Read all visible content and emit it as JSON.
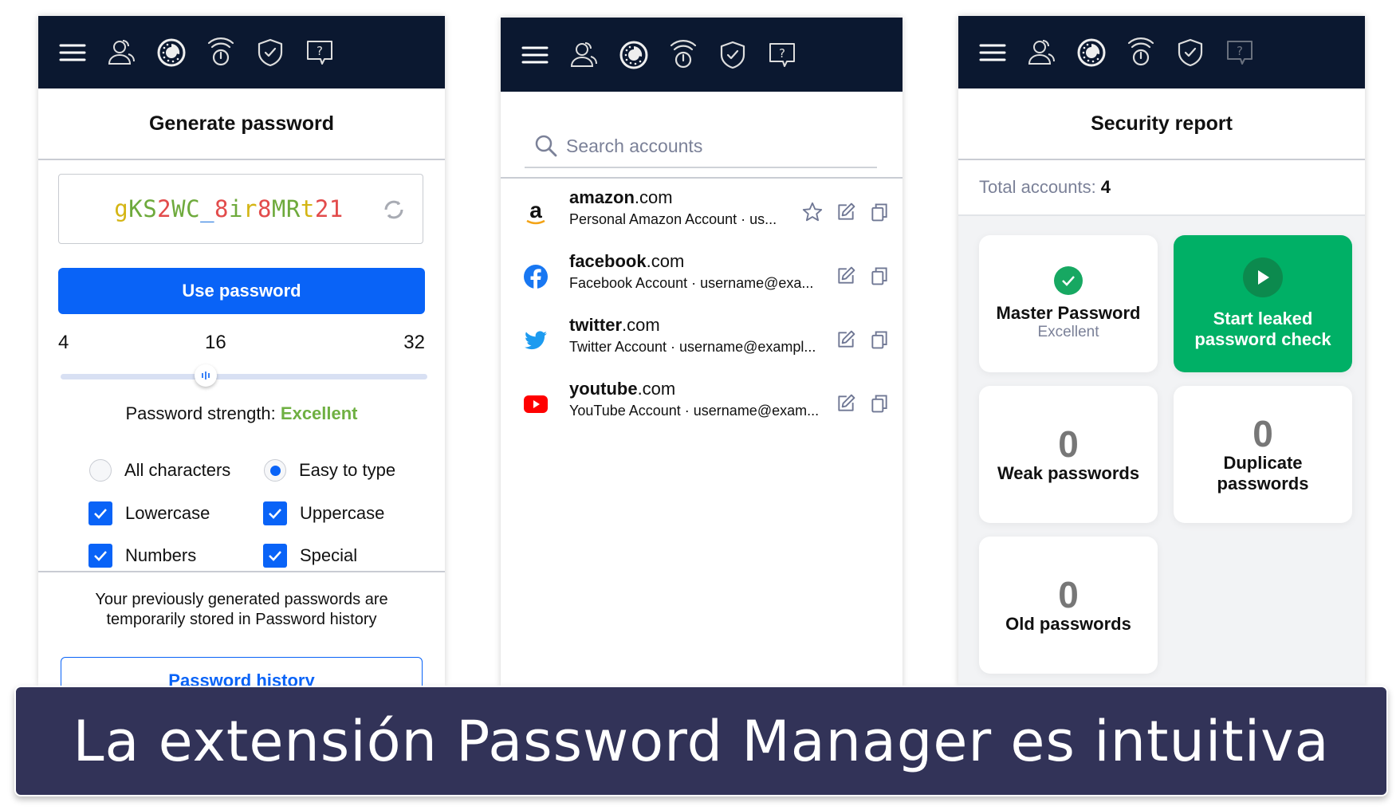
{
  "toolbar": {
    "icons": [
      "menu-icon",
      "accounts-icon",
      "identity-dial-icon",
      "authenticator-icon",
      "security-shield-icon",
      "help-chat-icon"
    ]
  },
  "generator": {
    "title": "Generate password",
    "password": "gKS2WC_8ir8MRt21",
    "password_chars": [
      {
        "c": "g",
        "color": "#d4b514"
      },
      {
        "c": "K",
        "color": "#6eaa3c"
      },
      {
        "c": "S",
        "color": "#6eaa3c"
      },
      {
        "c": "2",
        "color": "#e24b4b"
      },
      {
        "c": "W",
        "color": "#6eaa3c"
      },
      {
        "c": "C",
        "color": "#6eaa3c"
      },
      {
        "c": "_",
        "color": "#2a7be0"
      },
      {
        "c": "8",
        "color": "#e24b4b"
      },
      {
        "c": "i",
        "color": "#6eaa3c"
      },
      {
        "c": "r",
        "color": "#d4b514"
      },
      {
        "c": "8",
        "color": "#e24b4b"
      },
      {
        "c": "M",
        "color": "#6eaa3c"
      },
      {
        "c": "R",
        "color": "#6eaa3c"
      },
      {
        "c": "t",
        "color": "#d4b514"
      },
      {
        "c": "2",
        "color": "#e24b4b"
      },
      {
        "c": "1",
        "color": "#e24b4b"
      }
    ],
    "use_button": "Use password",
    "length_min": "4",
    "length_value": "16",
    "length_max": "32",
    "strength_label": "Password strength:",
    "strength_value": "Excellent",
    "options": {
      "all_characters": {
        "label": "All characters",
        "selected": false
      },
      "easy_to_type": {
        "label": "Easy to type",
        "selected": true
      },
      "lowercase": {
        "label": "Lowercase",
        "checked": true
      },
      "uppercase": {
        "label": "Uppercase",
        "checked": true
      },
      "numbers": {
        "label": "Numbers",
        "checked": true
      },
      "special": {
        "label": "Special",
        "checked": true
      }
    },
    "history_note_1": "Your previously generated passwords are",
    "history_note_2": "temporarily stored in Password history",
    "history_button": "Password history"
  },
  "accounts": {
    "search_placeholder": "Search accounts",
    "items": [
      {
        "name": "amazon",
        "tld": ".com",
        "sub": "Personal Amazon Account · us...",
        "starred_icon": true,
        "logo": "amazon-logo"
      },
      {
        "name": "facebook",
        "tld": ".com",
        "sub": "Facebook Account · username@exa...",
        "starred_icon": false,
        "logo": "facebook-logo"
      },
      {
        "name": "twitter",
        "tld": ".com",
        "sub": "Twitter Account · username@exampl...",
        "starred_icon": false,
        "logo": "twitter-logo"
      },
      {
        "name": "youtube",
        "tld": ".com",
        "sub": "YouTube Account · username@exam...",
        "starred_icon": false,
        "logo": "youtube-logo"
      }
    ]
  },
  "security": {
    "title": "Security report",
    "total_label": "Total accounts:",
    "total_value": "4",
    "master": {
      "label": "Master Password",
      "status": "Excellent"
    },
    "leak_check": {
      "line1": "Start leaked",
      "line2": "password check"
    },
    "weak": {
      "count": "0",
      "label": "Weak passwords"
    },
    "duplicate": {
      "count": "0",
      "label1": "Duplicate",
      "label2": "passwords"
    },
    "old": {
      "count": "0",
      "label": "Old passwords"
    }
  },
  "banner": {
    "text": "La extensión Password Manager es intuitiva"
  }
}
